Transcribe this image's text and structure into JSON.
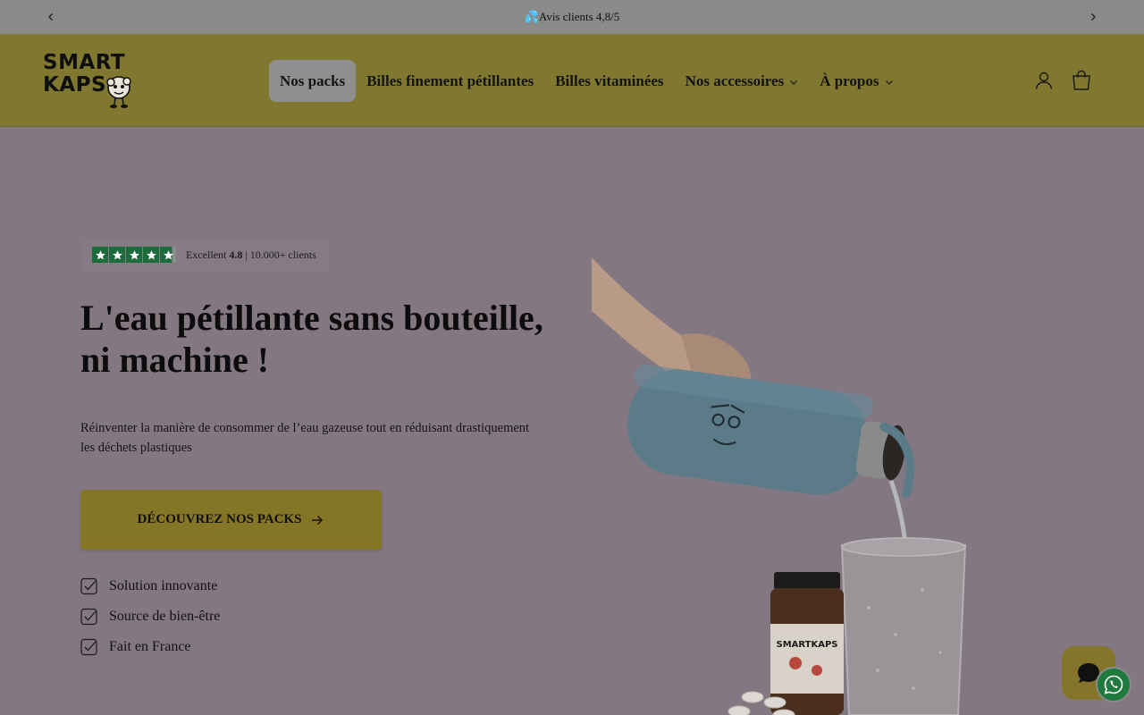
{
  "announcement": {
    "icon": "water-drops-icon",
    "text": "💦Avis clients 4,8/5"
  },
  "header": {
    "logo": {
      "line1": "SMART",
      "line2": "KAPS"
    },
    "nav": [
      {
        "label": "Nos packs",
        "active": true,
        "dropdown": false
      },
      {
        "label": "Billes finement pétillantes",
        "active": false,
        "dropdown": false
      },
      {
        "label": "Billes vitaminées",
        "active": false,
        "dropdown": false
      },
      {
        "label": "Nos accessoires",
        "active": false,
        "dropdown": true
      },
      {
        "label": "À propos",
        "active": false,
        "dropdown": true
      }
    ],
    "icons": [
      "account-icon",
      "cart-icon"
    ]
  },
  "hero": {
    "rating": {
      "stars": 4.8,
      "label_prefix": "Excellent ",
      "score": "4.8",
      "label_suffix": " | 10.000+ clients"
    },
    "title": "L'eau pétillante sans bouteille, ni machine !",
    "subtitle": "Réinventer la manière de consommer de l’eau gazeuse tout en réduisant drastiquement les déchets plastiques",
    "cta_label": "DÉCOUVREZ NOS PACKS",
    "features": [
      "Solution innovante",
      "Source de bien-être",
      "Fait en France"
    ]
  },
  "floating": {
    "chat_icon": "chat-bubble-icon",
    "whatsapp_icon": "whatsapp-icon"
  },
  "colors": {
    "overlay_bg": "#837882",
    "header_bg": "#80782f",
    "cta_bg": "#857526",
    "trustpilot_green": "#1d6b3a",
    "whatsapp_green": "#1f7a3e"
  }
}
